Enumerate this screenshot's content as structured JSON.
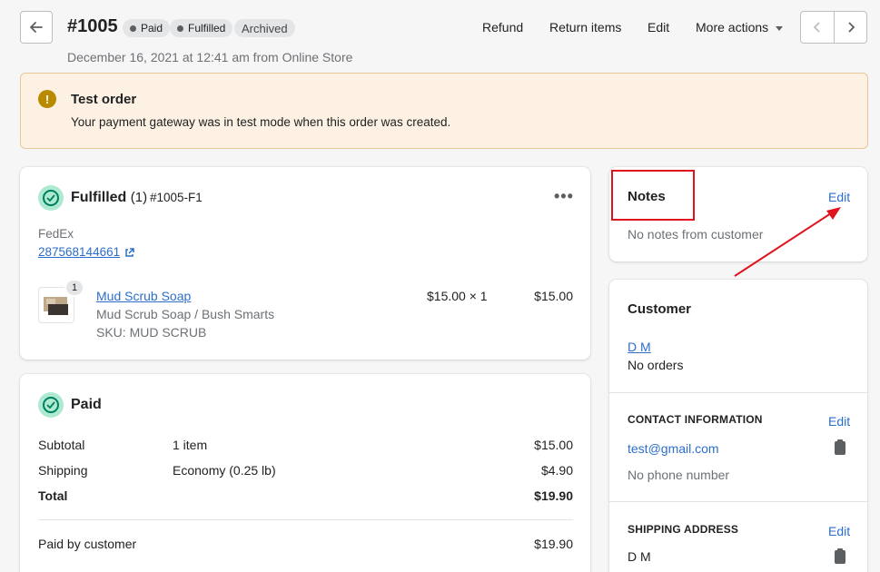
{
  "header": {
    "order_number": "#1005",
    "badges": {
      "paid": "Paid",
      "fulfilled": "Fulfilled",
      "archived": "Archived"
    },
    "subtitle": "December 16, 2021 at 12:41 am from Online Store",
    "actions": {
      "refund": "Refund",
      "return_items": "Return items",
      "edit": "Edit",
      "more_actions": "More actions"
    }
  },
  "banner": {
    "title": "Test order",
    "text": "Your payment gateway was in test mode when this order was created."
  },
  "fulfilled": {
    "title": "Fulfilled",
    "count": "(1)",
    "fulfillment_id": "#1005-F1",
    "carrier": "FedEx",
    "tracking_number": "287568144661",
    "item": {
      "name": "Mud Scrub Soap",
      "variant": "Mud Scrub Soap / Bush Smarts",
      "sku": "SKU: MUD SCRUB",
      "price_qty": "$15.00 × 1",
      "total": "$15.00",
      "quantity_badge": "1"
    }
  },
  "paid": {
    "title": "Paid",
    "rows": [
      {
        "label": "Subtotal",
        "detail": "1 item",
        "amount": "$15.00"
      },
      {
        "label": "Shipping",
        "detail": "Economy (0.25 lb)",
        "amount": "$4.90"
      },
      {
        "label": "Total",
        "detail": "",
        "amount": "$19.90"
      }
    ],
    "paid_by_label": "Paid by customer",
    "paid_by_amount": "$19.90"
  },
  "notes": {
    "title": "Notes",
    "edit": "Edit",
    "empty": "No notes from customer"
  },
  "customer": {
    "title": "Customer",
    "name": "D M",
    "orders": "No orders",
    "contact_heading": "CONTACT INFORMATION",
    "contact_edit": "Edit",
    "email": "test@gmail.com",
    "phone": "No phone number",
    "shipping_heading": "SHIPPING ADDRESS",
    "shipping_edit": "Edit",
    "shipping_name": "D M"
  },
  "colors": {
    "accent_link": "#2c6ecb",
    "annotation_red": "#e0141e",
    "banner_bg": "#fdf1e4",
    "success_green": "#007f5f"
  }
}
